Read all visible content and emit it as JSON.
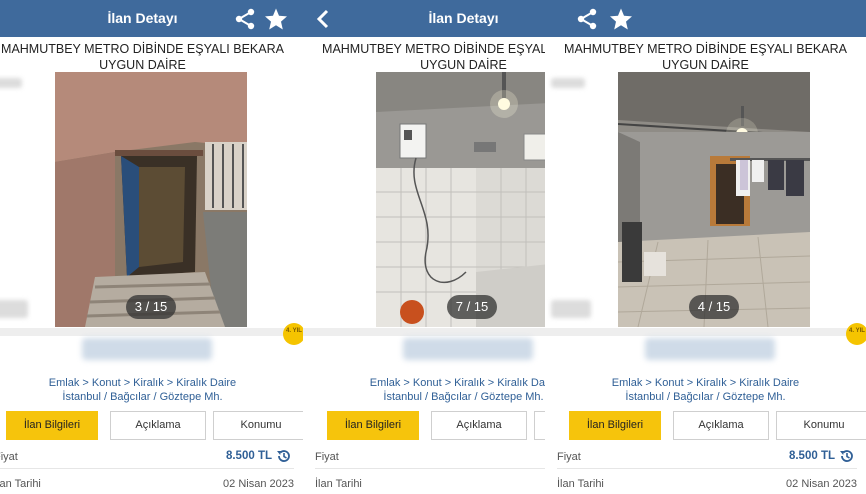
{
  "header": {
    "title": "İlan Detayı"
  },
  "listing": {
    "title": "MAHMUTBEY METRO DİBİNDE EŞYALI BEKARA UYGUN DAİRE",
    "breadcrumb": "Emlak > Konut > Kiralık > Kiralık Daire",
    "location": "İstanbul / Bağcılar / Göztepe Mh.",
    "price_label": "Fiyat",
    "price": "8.500 TL",
    "date_label": "İlan Tarihi",
    "date": "02 Nisan 2023",
    "badge": "4. YIL"
  },
  "tabs": [
    "İlan Bilgileri",
    "Açıklama",
    "Konumu"
  ],
  "screens": [
    {
      "counter": "3 / 15"
    },
    {
      "counter": "7 / 15"
    },
    {
      "counter": "4 / 15"
    }
  ],
  "colors": {
    "header": "#3f6a9c",
    "accent": "#f6c40c",
    "link": "#2f5f96"
  }
}
